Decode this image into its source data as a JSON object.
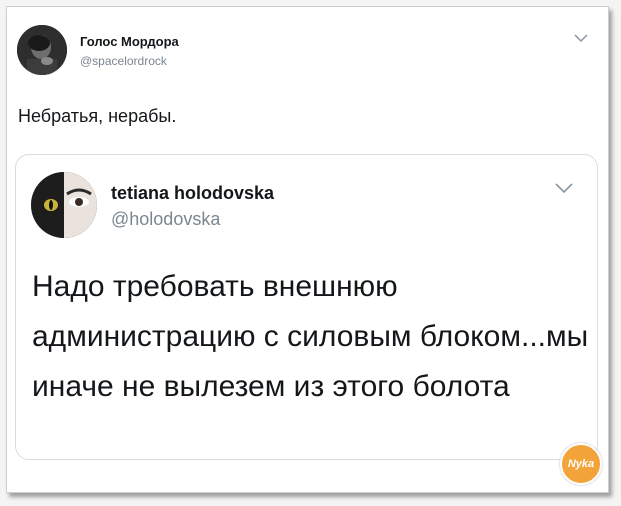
{
  "tweet": {
    "author_name": "Голос Мордора",
    "author_handle": "@spacelordrock",
    "text": "Небратья, нерабы.",
    "menu_icon": "chevron-down-icon"
  },
  "quoted_tweet": {
    "author_name": "tetiana holodovska",
    "author_handle": "@holodovska",
    "text": "Надо требовать внешнюю администрацию с силовым блоком...мы иначе не вылезем из этого болота",
    "menu_icon": "chevron-down-icon"
  },
  "watermark": {
    "text": "Nyka"
  },
  "colors": {
    "text": "#14171a",
    "secondary": "#7a8691",
    "border": "#d6dde3",
    "watermark": "#f2a33a"
  }
}
